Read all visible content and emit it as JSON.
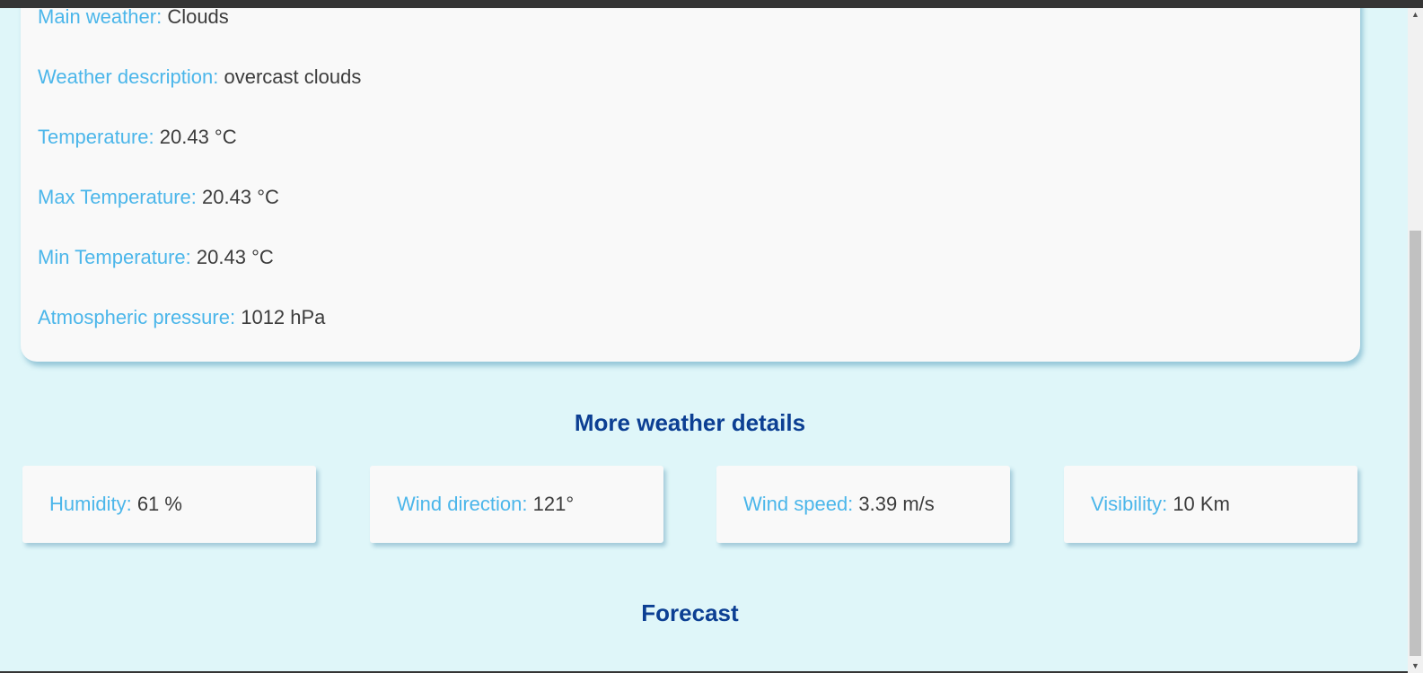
{
  "current": {
    "rows": [
      {
        "label": "Main weather:",
        "value": "Clouds"
      },
      {
        "label": "Weather description:",
        "value": "overcast clouds"
      },
      {
        "label": "Temperature:",
        "value": "20.43 °C"
      },
      {
        "label": "Max Temperature:",
        "value": "20.43 °C"
      },
      {
        "label": "Min Temperature:",
        "value": "20.43 °C"
      },
      {
        "label": "Atmospheric pressure:",
        "value": "1012 hPa"
      }
    ]
  },
  "details": {
    "title": "More weather details",
    "cards": [
      {
        "label": "Humidity:",
        "value": "61 %"
      },
      {
        "label": "Wind direction:",
        "value": "121°"
      },
      {
        "label": "Wind speed:",
        "value": "3.39 m/s"
      },
      {
        "label": "Visibility:",
        "value": "10 Km"
      }
    ]
  },
  "forecast": {
    "title": "Forecast"
  },
  "scrollbar": {
    "up_icon": "triangle-up",
    "down_icon": "triangle-down",
    "position_fraction": 0.33
  },
  "colors": {
    "page_background": "#dff6f9",
    "card_background": "#f9f9f9",
    "label": "#4bb6ea",
    "value": "#3c3c3c",
    "heading": "#0c3f93"
  }
}
